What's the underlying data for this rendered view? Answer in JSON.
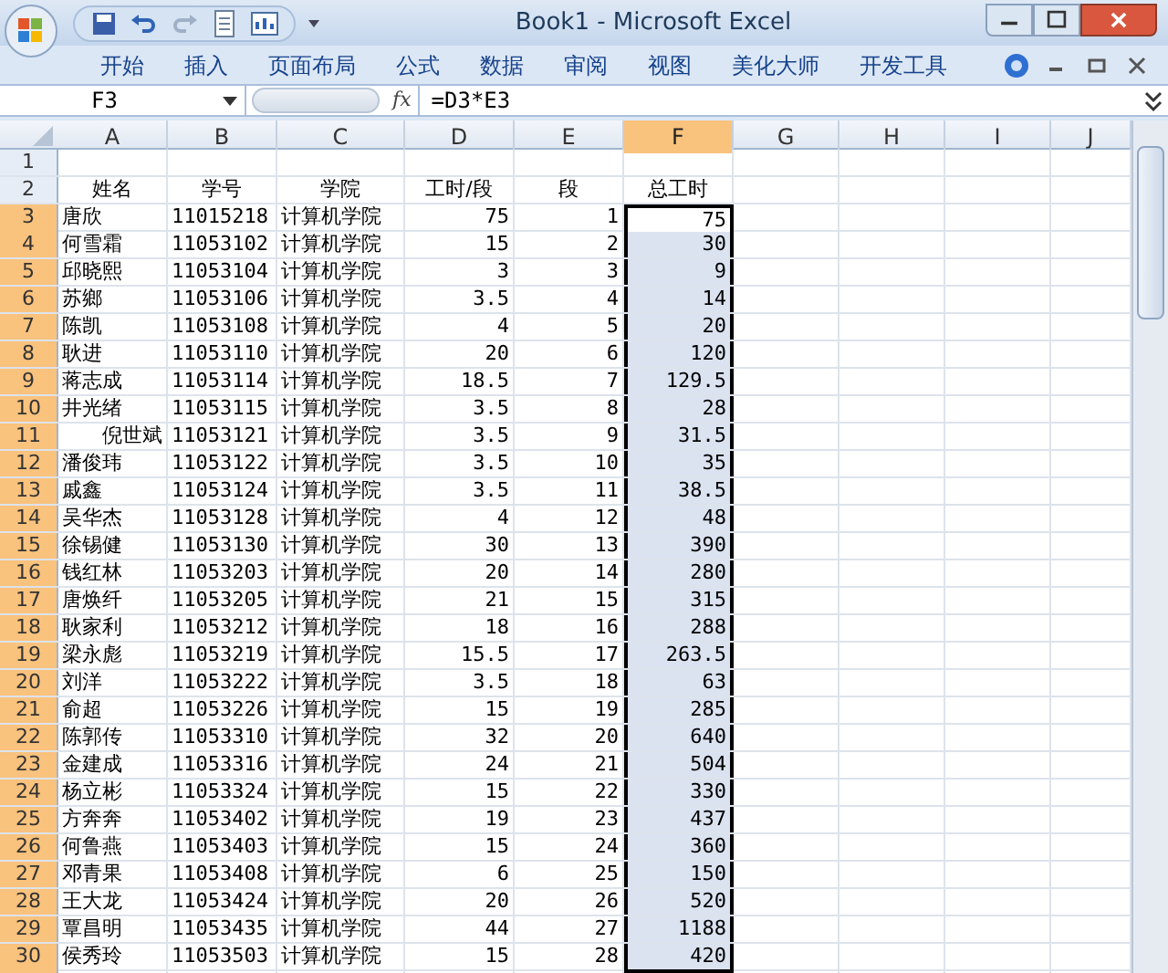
{
  "window": {
    "title": "Book1 - Microsoft Excel"
  },
  "ribbon_tabs": [
    {
      "label": "开始",
      "selected": false
    },
    {
      "label": "插入",
      "selected": false
    },
    {
      "label": "页面布局",
      "selected": false
    },
    {
      "label": "公式",
      "selected": false
    },
    {
      "label": "数据",
      "selected": false
    },
    {
      "label": "审阅",
      "selected": false
    },
    {
      "label": "视图",
      "selected": false
    },
    {
      "label": "美化大师",
      "selected": false
    },
    {
      "label": "开发工具",
      "selected": false
    }
  ],
  "formula_bar": {
    "name_box": "F3",
    "fx": "fx",
    "formula": "=D3*E3"
  },
  "columns": [
    {
      "label": "A",
      "selected": false
    },
    {
      "label": "B",
      "selected": false
    },
    {
      "label": "C",
      "selected": false
    },
    {
      "label": "D",
      "selected": false
    },
    {
      "label": "E",
      "selected": false
    },
    {
      "label": "F",
      "selected": true
    },
    {
      "label": "G",
      "selected": false
    },
    {
      "label": "H",
      "selected": false
    },
    {
      "label": "I",
      "selected": false
    },
    {
      "label": "J",
      "selected": false
    }
  ],
  "rows": [
    {
      "header": "1",
      "kind": "empty",
      "selected": false
    },
    {
      "header": "2",
      "kind": "header",
      "selected": false,
      "cells": [
        "姓名",
        "学号",
        "学院",
        "工时/段",
        "段",
        "总工时"
      ]
    },
    {
      "header": "3",
      "kind": "data",
      "selected": true,
      "active": true,
      "name_right": false,
      "cells": [
        "唐欣",
        "11015218",
        "计算机学院",
        "75",
        "1",
        "75"
      ]
    },
    {
      "header": "4",
      "kind": "data",
      "selected": true,
      "active": false,
      "name_right": false,
      "cells": [
        "何雪霜",
        "11053102",
        "计算机学院",
        "15",
        "2",
        "30"
      ]
    },
    {
      "header": "5",
      "kind": "data",
      "selected": true,
      "active": false,
      "name_right": false,
      "cells": [
        "邱晓熙",
        "11053104",
        "计算机学院",
        "3",
        "3",
        "9"
      ]
    },
    {
      "header": "6",
      "kind": "data",
      "selected": true,
      "active": false,
      "name_right": false,
      "cells": [
        "苏鄉",
        "11053106",
        "计算机学院",
        "3.5",
        "4",
        "14"
      ]
    },
    {
      "header": "7",
      "kind": "data",
      "selected": true,
      "active": false,
      "name_right": false,
      "cells": [
        "陈凯",
        "11053108",
        "计算机学院",
        "4",
        "5",
        "20"
      ]
    },
    {
      "header": "8",
      "kind": "data",
      "selected": true,
      "active": false,
      "name_right": false,
      "cells": [
        "耿进",
        "11053110",
        "计算机学院",
        "20",
        "6",
        "120"
      ]
    },
    {
      "header": "9",
      "kind": "data",
      "selected": true,
      "active": false,
      "name_right": false,
      "cells": [
        "蒋志成",
        "11053114",
        "计算机学院",
        "18.5",
        "7",
        "129.5"
      ]
    },
    {
      "header": "10",
      "kind": "data",
      "selected": true,
      "active": false,
      "name_right": false,
      "cells": [
        "井光绪",
        "11053115",
        "计算机学院",
        "3.5",
        "8",
        "28"
      ]
    },
    {
      "header": "11",
      "kind": "data",
      "selected": true,
      "active": false,
      "name_right": true,
      "cells": [
        "倪世斌",
        "11053121",
        "计算机学院",
        "3.5",
        "9",
        "31.5"
      ]
    },
    {
      "header": "12",
      "kind": "data",
      "selected": true,
      "active": false,
      "name_right": false,
      "cells": [
        "潘俊玮",
        "11053122",
        "计算机学院",
        "3.5",
        "10",
        "35"
      ]
    },
    {
      "header": "13",
      "kind": "data",
      "selected": true,
      "active": false,
      "name_right": false,
      "cells": [
        "戚鑫",
        "11053124",
        "计算机学院",
        "3.5",
        "11",
        "38.5"
      ]
    },
    {
      "header": "14",
      "kind": "data",
      "selected": true,
      "active": false,
      "name_right": false,
      "cells": [
        "吴华杰",
        "11053128",
        "计算机学院",
        "4",
        "12",
        "48"
      ]
    },
    {
      "header": "15",
      "kind": "data",
      "selected": true,
      "active": false,
      "name_right": false,
      "cells": [
        "徐锡健",
        "11053130",
        "计算机学院",
        "30",
        "13",
        "390"
      ]
    },
    {
      "header": "16",
      "kind": "data",
      "selected": true,
      "active": false,
      "name_right": false,
      "cells": [
        "钱红林",
        "11053203",
        "计算机学院",
        "20",
        "14",
        "280"
      ]
    },
    {
      "header": "17",
      "kind": "data",
      "selected": true,
      "active": false,
      "name_right": false,
      "cells": [
        "唐焕纤",
        "11053205",
        "计算机学院",
        "21",
        "15",
        "315"
      ]
    },
    {
      "header": "18",
      "kind": "data",
      "selected": true,
      "active": false,
      "name_right": false,
      "cells": [
        "耿家利",
        "11053212",
        "计算机学院",
        "18",
        "16",
        "288"
      ]
    },
    {
      "header": "19",
      "kind": "data",
      "selected": true,
      "active": false,
      "name_right": false,
      "cells": [
        "梁永彪",
        "11053219",
        "计算机学院",
        "15.5",
        "17",
        "263.5"
      ]
    },
    {
      "header": "20",
      "kind": "data",
      "selected": true,
      "active": false,
      "name_right": false,
      "cells": [
        "刘洋",
        "11053222",
        "计算机学院",
        "3.5",
        "18",
        "63"
      ]
    },
    {
      "header": "21",
      "kind": "data",
      "selected": true,
      "active": false,
      "name_right": false,
      "cells": [
        "俞超",
        "11053226",
        "计算机学院",
        "15",
        "19",
        "285"
      ]
    },
    {
      "header": "22",
      "kind": "data",
      "selected": true,
      "active": false,
      "name_right": false,
      "cells": [
        "陈郭传",
        "11053310",
        "计算机学院",
        "32",
        "20",
        "640"
      ]
    },
    {
      "header": "23",
      "kind": "data",
      "selected": true,
      "active": false,
      "name_right": false,
      "cells": [
        "金建成",
        "11053316",
        "计算机学院",
        "24",
        "21",
        "504"
      ]
    },
    {
      "header": "24",
      "kind": "data",
      "selected": true,
      "active": false,
      "name_right": false,
      "cells": [
        "杨立彬",
        "11053324",
        "计算机学院",
        "15",
        "22",
        "330"
      ]
    },
    {
      "header": "25",
      "kind": "data",
      "selected": true,
      "active": false,
      "name_right": false,
      "cells": [
        "方奔奔",
        "11053402",
        "计算机学院",
        "19",
        "23",
        "437"
      ]
    },
    {
      "header": "26",
      "kind": "data",
      "selected": true,
      "active": false,
      "name_right": false,
      "cells": [
        "何鲁燕",
        "11053403",
        "计算机学院",
        "15",
        "24",
        "360"
      ]
    },
    {
      "header": "27",
      "kind": "data",
      "selected": true,
      "active": false,
      "name_right": false,
      "cells": [
        "邓青果",
        "11053408",
        "计算机学院",
        "6",
        "25",
        "150"
      ]
    },
    {
      "header": "28",
      "kind": "data",
      "selected": true,
      "active": false,
      "name_right": false,
      "cells": [
        "王大龙",
        "11053424",
        "计算机学院",
        "20",
        "26",
        "520"
      ]
    },
    {
      "header": "29",
      "kind": "data",
      "selected": true,
      "active": false,
      "name_right": false,
      "cells": [
        "覃昌明",
        "11053435",
        "计算机学院",
        "44",
        "27",
        "1188"
      ]
    },
    {
      "header": "30",
      "kind": "data",
      "selected": true,
      "active": false,
      "name_right": false,
      "cells": [
        "侯秀玲",
        "11053503",
        "计算机学院",
        "15",
        "28",
        "420"
      ]
    }
  ]
}
